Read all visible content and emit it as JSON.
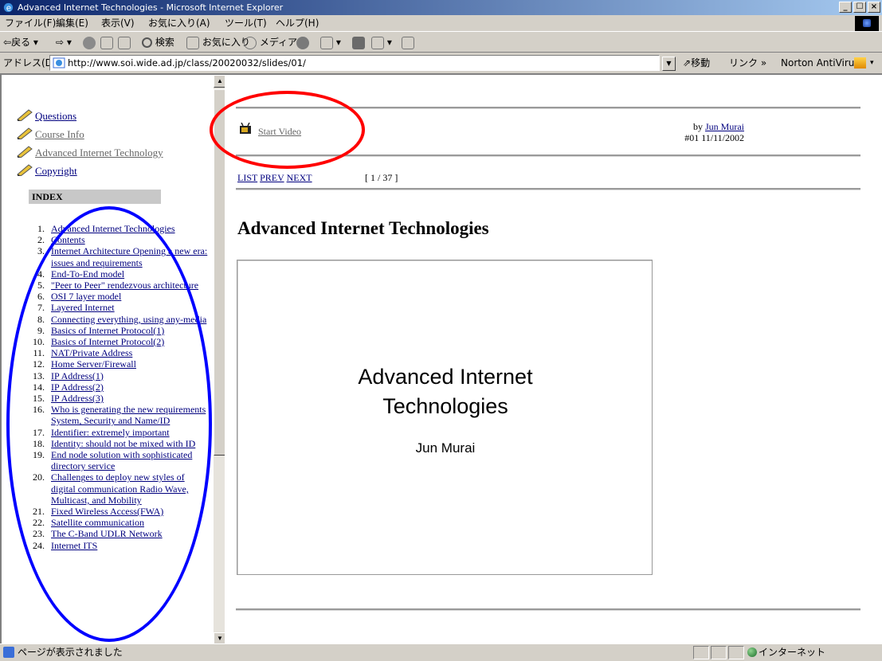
{
  "window": {
    "title": "Advanced Internet Technologies - Microsoft Internet Explorer",
    "controls": [
      "_",
      "☐",
      "×"
    ]
  },
  "menubar": [
    "ファイル(F)",
    "編集(E)",
    "表示(V)",
    "お気に入り(A)",
    "ツール(T)",
    "ヘルプ(H)"
  ],
  "toolbar": {
    "back": "戻る",
    "search": "検索",
    "favorites": "お気に入り",
    "media": "メディア"
  },
  "address": {
    "label": "アドレス(D)",
    "url": "http://www.soi.wide.ad.jp/class/20020032/slides/01/",
    "go": "移動",
    "links": "リンク »",
    "norton": "Norton AntiVirus"
  },
  "sidebar": {
    "links": [
      "Questions",
      "Course Info",
      "Advanced Internet Technology",
      "Copyright"
    ],
    "index_title": "INDEX",
    "index": [
      {
        "n": "1.",
        "label": "Advanced Internet Technologies"
      },
      {
        "n": "2.",
        "label": "Contents"
      },
      {
        "n": "3.",
        "label": "Internet Architecture Opening a new era: issues and requirements"
      },
      {
        "n": "4.",
        "label": "End-To-End model"
      },
      {
        "n": "5.",
        "label": "\"Peer to Peer\" rendezvous architecture"
      },
      {
        "n": "6.",
        "label": "OSI 7 layer model"
      },
      {
        "n": "7.",
        "label": "Layered Internet"
      },
      {
        "n": "8.",
        "label": "Connecting everything, using any-media"
      },
      {
        "n": "9.",
        "label": "Basics of Internet Protocol(1)"
      },
      {
        "n": "10.",
        "label": "Basics of Internet Protocol(2)"
      },
      {
        "n": "11.",
        "label": "NAT/Private Address"
      },
      {
        "n": "12.",
        "label": "Home Server/Firewall"
      },
      {
        "n": "13.",
        "label": "IP Address(1)"
      },
      {
        "n": "14.",
        "label": "IP Address(2)"
      },
      {
        "n": "15.",
        "label": "IP Address(3)"
      },
      {
        "n": "16.",
        "label": "Who is generating the new requirements System, Security and Name/ID"
      },
      {
        "n": "17.",
        "label": "Identifier: extremely important"
      },
      {
        "n": "18.",
        "label": "Identity: should not be mixed with ID"
      },
      {
        "n": "19.",
        "label": "End node solution with sophisticated directory service"
      },
      {
        "n": "20.",
        "label": "Challenges to deploy new styles of digital communication Radio Wave, Multicast, and Mobility"
      },
      {
        "n": "21.",
        "label": "Fixed Wireless Access(FWA)"
      },
      {
        "n": "22.",
        "label": "Satellite communication"
      },
      {
        "n": "23.",
        "label": "The C-Band UDLR Network"
      },
      {
        "n": "24.",
        "label": "Internet ITS"
      }
    ]
  },
  "main": {
    "start_video": "Start Video",
    "by": "by",
    "author_link": "Jun Murai",
    "slide_info": "#01 11/11/2002",
    "nav": {
      "list": "LIST",
      "prev": "PREV",
      "counter": "[ 1 / 37 ]",
      "next": "NEXT"
    },
    "title": "Advanced Internet Technologies",
    "slide": {
      "line1": "Advanced Internet",
      "line2": "Technologies",
      "author": "Jun Murai"
    }
  },
  "status": {
    "text": "ページが表示されました",
    "zone": "インターネット"
  },
  "colors": {
    "link": "#00007f",
    "visited": "#666666",
    "annotation_red": "#ff0000",
    "annotation_blue": "#0000ff",
    "titlebar": "#0a246a"
  }
}
